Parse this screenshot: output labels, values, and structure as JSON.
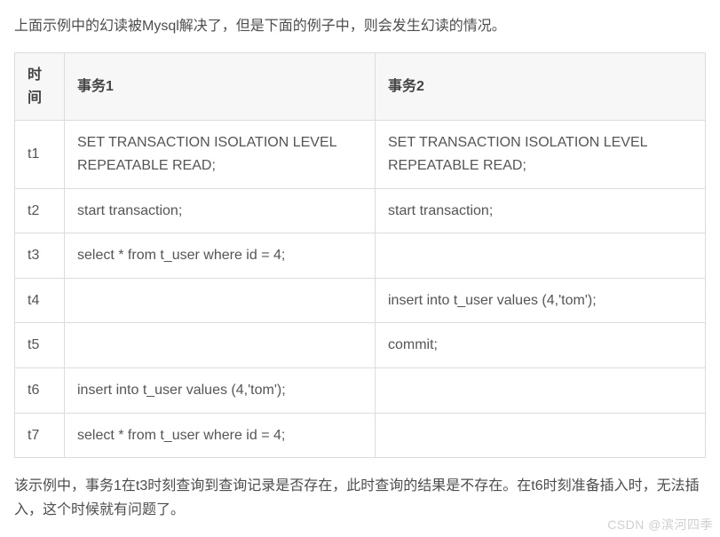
{
  "intro": "上面示例中的幻读被Mysql解决了，但是下面的例子中，则会发生幻读的情况。",
  "outro": "该示例中，事务1在t3时刻查询到查询记录是否存在，此时查询的结果是不存在。在t6时刻准备插入时，无法插入，这个时候就有问题了。",
  "watermark": "CSDN @滨河四季",
  "table": {
    "headers": {
      "time": "时间",
      "tx1": "事务1",
      "tx2": "事务2"
    },
    "rows": [
      {
        "time": "t1",
        "tx1": "SET TRANSACTION ISOLATION LEVEL REPEATABLE READ;",
        "tx2": "SET TRANSACTION ISOLATION LEVEL REPEATABLE READ;"
      },
      {
        "time": "t2",
        "tx1": "start transaction;",
        "tx2": "start transaction;"
      },
      {
        "time": "t3",
        "tx1": "select * from t_user where id = 4;",
        "tx2": ""
      },
      {
        "time": "t4",
        "tx1": "",
        "tx2": "insert into t_user values (4,'tom');"
      },
      {
        "time": "t5",
        "tx1": "",
        "tx2": "commit;"
      },
      {
        "time": "t6",
        "tx1": "insert into t_user values (4,'tom');",
        "tx2": ""
      },
      {
        "time": "t7",
        "tx1": "select * from t_user where id = 4;",
        "tx2": ""
      }
    ]
  }
}
